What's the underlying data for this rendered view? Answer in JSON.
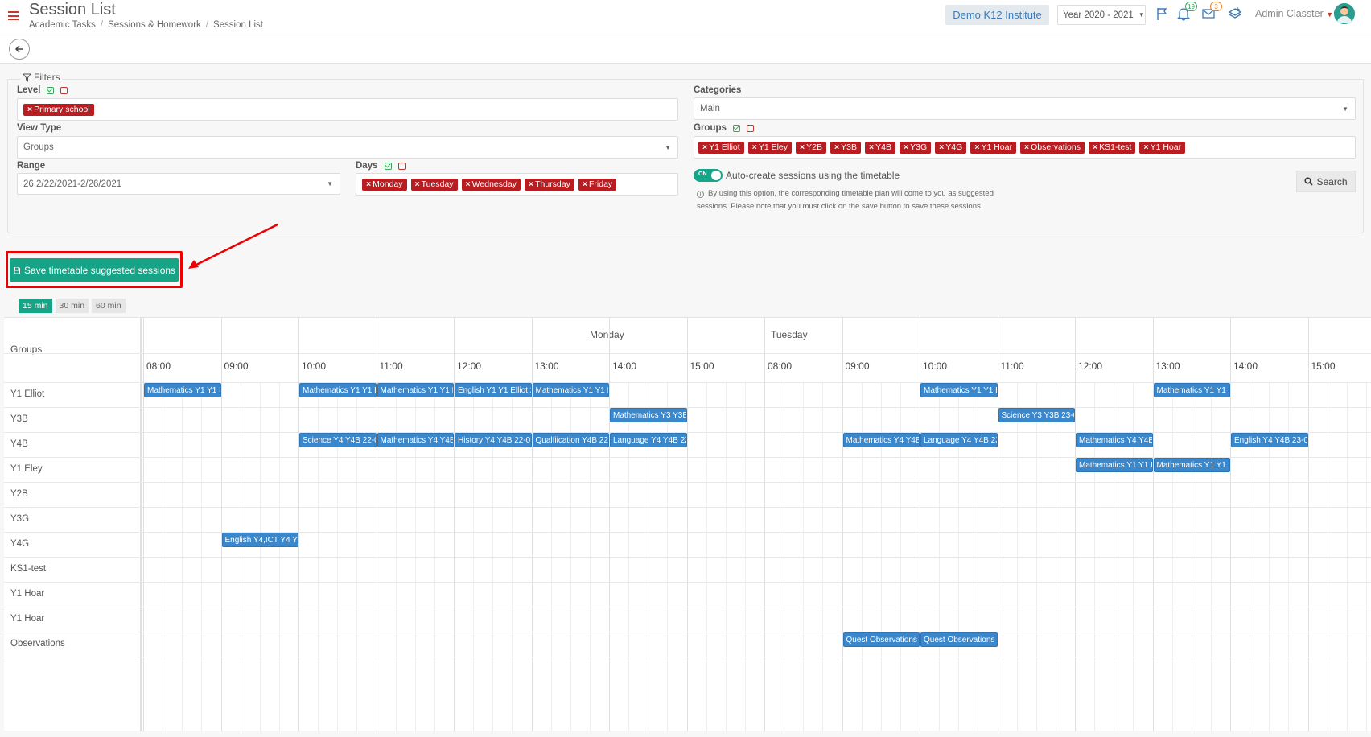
{
  "header": {
    "title": "Session List",
    "breadcrumb": [
      "Academic Tasks",
      "Sessions & Homework",
      "Session List"
    ],
    "institute": "Demo K12 Institute",
    "year": "Year 2020 - 2021",
    "notifications_count": "19",
    "messages_count": "3",
    "user": "Admin Classter",
    "icons": [
      "menu-icon",
      "flag-icon",
      "bell-icon",
      "mail-icon",
      "layers-icon",
      "avatar"
    ]
  },
  "filters": {
    "legend": "Filters",
    "level_label": "Level",
    "level_tags": [
      "Primary school"
    ],
    "viewtype_label": "View Type",
    "viewtype_value": "Groups",
    "range_label": "Range",
    "range_value": "26 2/22/2021-2/26/2021",
    "days_label": "Days",
    "days_tags": [
      "Monday",
      "Tuesday",
      "Wednesday",
      "Thursday",
      "Friday"
    ],
    "categories_label": "Categories",
    "categories_value": "Main",
    "groups_label": "Groups",
    "groups_tags": [
      "Y1 Elliot",
      "Y1 Eley",
      "Y2B",
      "Y3B",
      "Y4B",
      "Y3G",
      "Y4G",
      "Y1 Hoar",
      "Observations",
      "KS1-test",
      "Y1 Hoar"
    ],
    "toggle_on": "ON",
    "auto_create_label": "Auto-create sessions using the timetable",
    "info_text": "By using this option, the corresponding timetable plan will come to you as suggested sessions. Please note that you must click on the save button to save these sessions.",
    "search_label": "Search"
  },
  "actions": {
    "save_label": "Save timetable suggested sessions"
  },
  "intervals": [
    "15 min",
    "30 min",
    "60 min"
  ],
  "intervals_active": "15 min",
  "calendar": {
    "groups_header": "Groups",
    "days": [
      "Monday",
      "Tuesday"
    ],
    "times": [
      "08:00",
      "09:00",
      "10:00",
      "11:00",
      "12:00",
      "13:00",
      "14:00",
      "15:00"
    ],
    "rows": [
      "Y1 Elliot",
      "Y3B",
      "Y4B",
      "Y1 Eley",
      "Y2B",
      "Y3G",
      "Y4G",
      "KS1-test",
      "Y1 Hoar",
      "Y1 Hoar",
      "Observations"
    ],
    "events": [
      {
        "row": 0,
        "day": 0,
        "start": 0,
        "end": 1,
        "label": "Mathematics Y1 Y1 E"
      },
      {
        "row": 0,
        "day": 0,
        "start": 2,
        "end": 3,
        "label": "Mathematics Y1 Y1 E"
      },
      {
        "row": 0,
        "day": 0,
        "start": 3,
        "end": 4,
        "label": "Mathematics Y1 Y1 E"
      },
      {
        "row": 0,
        "day": 0,
        "start": 4,
        "end": 5,
        "label": "English Y1 Y1 Elliot 2"
      },
      {
        "row": 0,
        "day": 0,
        "start": 5,
        "end": 6,
        "label": "Mathematics Y1 Y1 E"
      },
      {
        "row": 0,
        "day": 1,
        "start": 2,
        "end": 3,
        "label": "Mathematics Y1 Y1 E"
      },
      {
        "row": 0,
        "day": 1,
        "start": 5,
        "end": 6,
        "label": "Mathematics Y1 Y1 E"
      },
      {
        "row": 1,
        "day": 0,
        "start": 6,
        "end": 7,
        "label": "Mathematics Y3 Y3B"
      },
      {
        "row": 1,
        "day": 1,
        "start": 3,
        "end": 4,
        "label": "Science Y3 Y3B 23-0:"
      },
      {
        "row": 2,
        "day": 0,
        "start": 2,
        "end": 3,
        "label": "Science Y4 Y4B 22-0:"
      },
      {
        "row": 2,
        "day": 0,
        "start": 3,
        "end": 4,
        "label": "Mathematics Y4 Y4B"
      },
      {
        "row": 2,
        "day": 0,
        "start": 4,
        "end": 5,
        "label": "History Y4 Y4B 22-0:"
      },
      {
        "row": 2,
        "day": 0,
        "start": 5,
        "end": 6,
        "label": "Qualfiication Y4B 22"
      },
      {
        "row": 2,
        "day": 0,
        "start": 6,
        "end": 7,
        "label": "Language Y4 Y4B 22"
      },
      {
        "row": 2,
        "day": 1,
        "start": 1,
        "end": 2,
        "label": "Mathematics Y4 Y4B"
      },
      {
        "row": 2,
        "day": 1,
        "start": 2,
        "end": 3,
        "label": "Language Y4 Y4B 23"
      },
      {
        "row": 2,
        "day": 1,
        "start": 4,
        "end": 5,
        "label": "Mathematics Y4 Y4B"
      },
      {
        "row": 2,
        "day": 1,
        "start": 6,
        "end": 7,
        "label": "English Y4 Y4B 23-0:"
      },
      {
        "row": 3,
        "day": 1,
        "start": 4,
        "end": 5,
        "label": "Mathematics Y1 Y1 E"
      },
      {
        "row": 3,
        "day": 1,
        "start": 5,
        "end": 6,
        "label": "Mathematics Y1 Y1 E"
      },
      {
        "row": 6,
        "day": 0,
        "start": 1,
        "end": 2,
        "label": "English Y4,ICT Y4 Y4"
      },
      {
        "row": 10,
        "day": 1,
        "start": 1,
        "end": 2,
        "label": "Quest Observations"
      },
      {
        "row": 10,
        "day": 1,
        "start": 2,
        "end": 3,
        "label": "Quest Observations"
      }
    ]
  }
}
